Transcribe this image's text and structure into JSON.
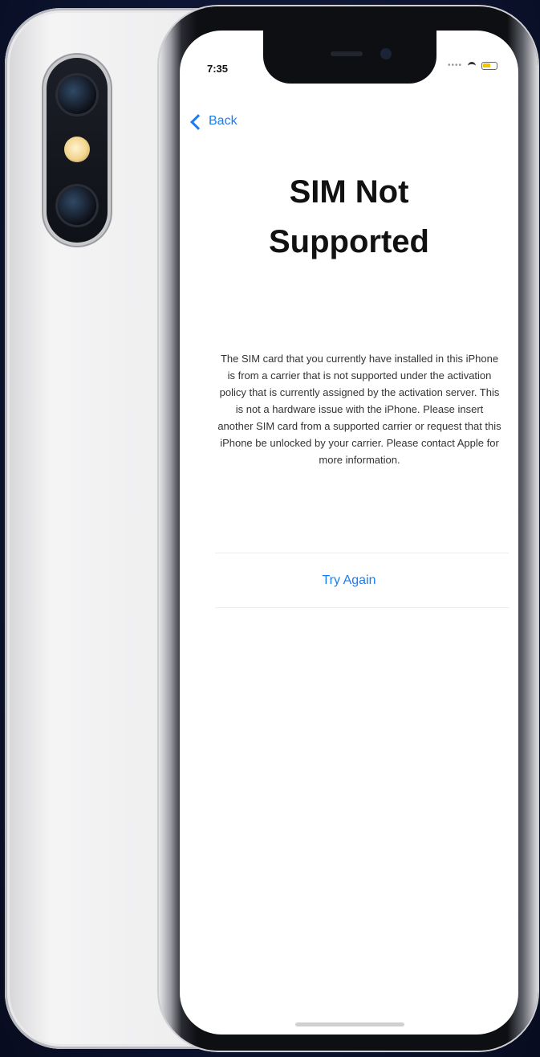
{
  "status_bar": {
    "time": "7:35",
    "signal": "••••"
  },
  "nav": {
    "back_label": "Back"
  },
  "content": {
    "title": "SIM Not Supported",
    "message": "The SIM card that you currently have installed in this iPhone is from a carrier that is not supported under the activation policy that is currently assigned by the activation server. This is not a hardware issue with the iPhone. Please insert another SIM card from a supported carrier or request that this iPhone be unlocked by your carrier. Please contact Apple for more information.",
    "try_again_label": "Try Again"
  },
  "colors": {
    "accent": "#1a7cf5",
    "background": "#0d1733"
  },
  "icons": {
    "back": "chevron-left-icon",
    "wifi": "wifi-icon",
    "battery": "battery-icon"
  }
}
